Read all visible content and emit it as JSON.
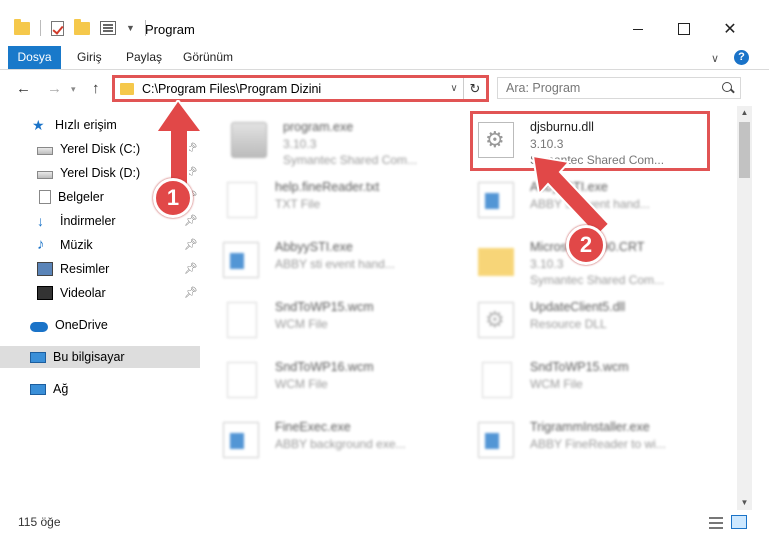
{
  "window": {
    "title": "Program",
    "minimize_icon": "minimize-icon",
    "maximize_icon": "maximize-icon",
    "close_label": "✕"
  },
  "ribbon": {
    "tabs": [
      {
        "label": "Dosya",
        "active": true
      },
      {
        "label": "Giriş"
      },
      {
        "label": "Paylaş"
      },
      {
        "label": "Görünüm"
      }
    ],
    "help_label": "?"
  },
  "address": {
    "path": "C:\\Program Files\\Program Dizini",
    "search_placeholder": "Ara: Program"
  },
  "sidebar": {
    "items": [
      {
        "label": "Hızlı erişim",
        "icon": "star-icon"
      },
      {
        "label": "Yerel Disk (C:)",
        "icon": "disk-icon",
        "pinned": true
      },
      {
        "label": "Yerel Disk (D:)",
        "icon": "disk-icon",
        "pinned": true
      },
      {
        "label": "Belgeler",
        "icon": "documents-icon",
        "pinned": true
      },
      {
        "label": "İndirmeler",
        "icon": "download-icon",
        "pinned": true
      },
      {
        "label": "Müzik",
        "icon": "music-icon",
        "pinned": true
      },
      {
        "label": "Resimler",
        "icon": "pictures-icon",
        "pinned": true
      },
      {
        "label": "Videolar",
        "icon": "video-icon",
        "pinned": true
      },
      {
        "label": "OneDrive",
        "icon": "cloud-icon"
      },
      {
        "label": "Bu bilgisayar",
        "icon": "computer-icon",
        "selected": true
      },
      {
        "label": "Ağ",
        "icon": "network-icon"
      }
    ]
  },
  "files": [
    {
      "name": "program.exe",
      "line2": "3.10.3",
      "line3": "Symantec Shared Com...",
      "icon": "setup-icon"
    },
    {
      "name": "djsburnu.dll",
      "line2": "3.10.3",
      "line3": "Symantec Shared Com...",
      "icon": "gear-file-icon",
      "highlighted": true
    },
    {
      "name": "help.fineReader.txt",
      "line2": "TXT File",
      "line3": "",
      "icon": "text-file-icon"
    },
    {
      "name": "AbbyySTI.exe",
      "line2": "ABBY sti event hand...",
      "line3": "",
      "icon": "exe-icon"
    },
    {
      "name": "AbbyySTI.exe",
      "line2": "ABBY sti event hand...",
      "line3": "",
      "icon": "exe-icon"
    },
    {
      "name": "Microsoft.VC90.CRT",
      "line2": "3.10.3",
      "line3": "Symantec Shared Com...",
      "icon": "folder-icon"
    },
    {
      "name": "SndToWP15.wcm",
      "line2": "WCM File",
      "line3": "",
      "icon": "text-file-icon"
    },
    {
      "name": "UpdateClient5.dll",
      "line2": "Resource DLL",
      "line3": "",
      "icon": "gear-file-icon"
    },
    {
      "name": "SndToWP16.wcm",
      "line2": "WCM File",
      "line3": "",
      "icon": "text-file-icon"
    },
    {
      "name": "SndToWP15.wcm",
      "line2": "WCM File",
      "line3": "",
      "icon": "text-file-icon"
    },
    {
      "name": "FineExec.exe",
      "line2": "ABBY background exe...",
      "line3": "",
      "icon": "exe-icon"
    },
    {
      "name": "TrigrammInstaller.exe",
      "line2": "ABBY FineReader to wi...",
      "line3": "",
      "icon": "exe-icon"
    }
  ],
  "annotations": {
    "badge1": "1",
    "badge2": "2"
  },
  "status": {
    "item_count": "115 öğe"
  }
}
